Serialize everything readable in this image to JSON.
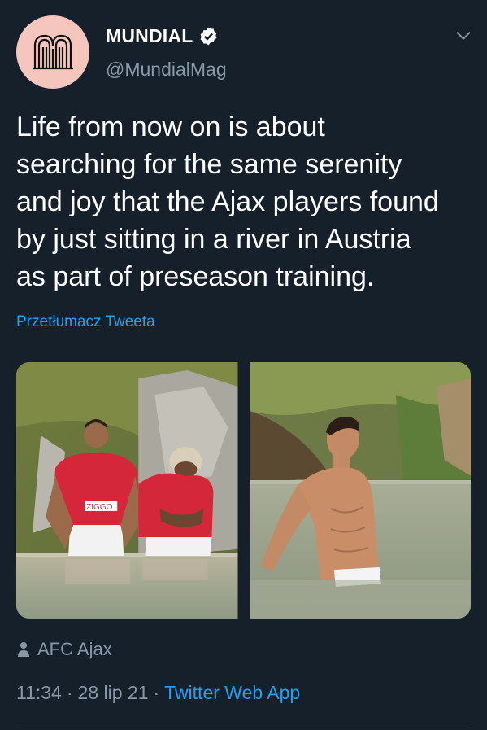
{
  "account": {
    "name": "MUNDIAL",
    "handle": "@MundialMag",
    "avatar_bg": "#f5c6bd",
    "verified": true
  },
  "tweet": {
    "text": "Life from now on is about\nsearching for the same serenity\nand joy that the Ajax players found\nby just sitting in a river in Austria\nas part of preseason training.",
    "translate_label": "Przetłumacz Tweeta"
  },
  "media": {
    "photo_left": {
      "icon": "photo-two-players-river",
      "shirt_sponsor": "ZIGGO"
    },
    "photo_right": {
      "icon": "photo-player-in-river"
    }
  },
  "location": {
    "icon": "person-pin-icon",
    "label": "AFC Ajax"
  },
  "meta": {
    "time": "11:34",
    "separator": "·",
    "date": "28 lip 21",
    "source": "Twitter Web App"
  },
  "colors": {
    "background": "#15202b",
    "text_secondary": "#8899a6",
    "link": "#1da1f2",
    "divider": "#38444d"
  }
}
